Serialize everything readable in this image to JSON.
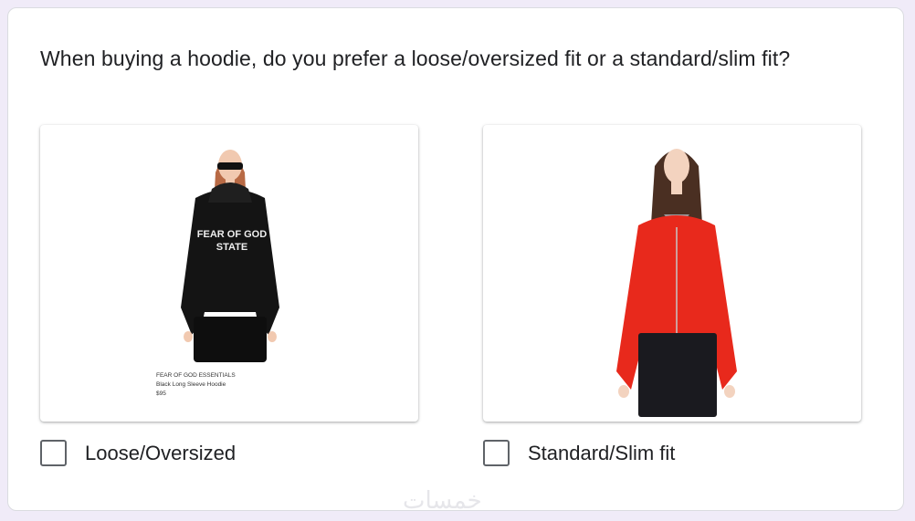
{
  "question": "When buying a hoodie, do you prefer a loose/oversized fit or a standard/slim fit?",
  "options": [
    {
      "label": "Loose/Oversized",
      "checked": false,
      "image": {
        "icon": "black-hoodie-model-photo",
        "hoodie_text_line1": "FEAR OF GOD",
        "hoodie_text_line2": "STATE",
        "caption_brand": "FEAR OF GOD ESSENTIALS",
        "caption_product": "Black Long Sleeve Hoodie",
        "caption_price": "$95"
      }
    },
    {
      "label": "Standard/Slim fit",
      "checked": false,
      "image": {
        "icon": "red-zip-hoodie-model-photo"
      }
    }
  ],
  "watermark": "خمسات",
  "colors": {
    "page_bg": "#f0ebf8",
    "card_bg": "#ffffff",
    "text": "#202124",
    "checkbox_border": "#5f6368",
    "hoodie_black": "#141414",
    "hoodie_red": "#e8291c"
  }
}
